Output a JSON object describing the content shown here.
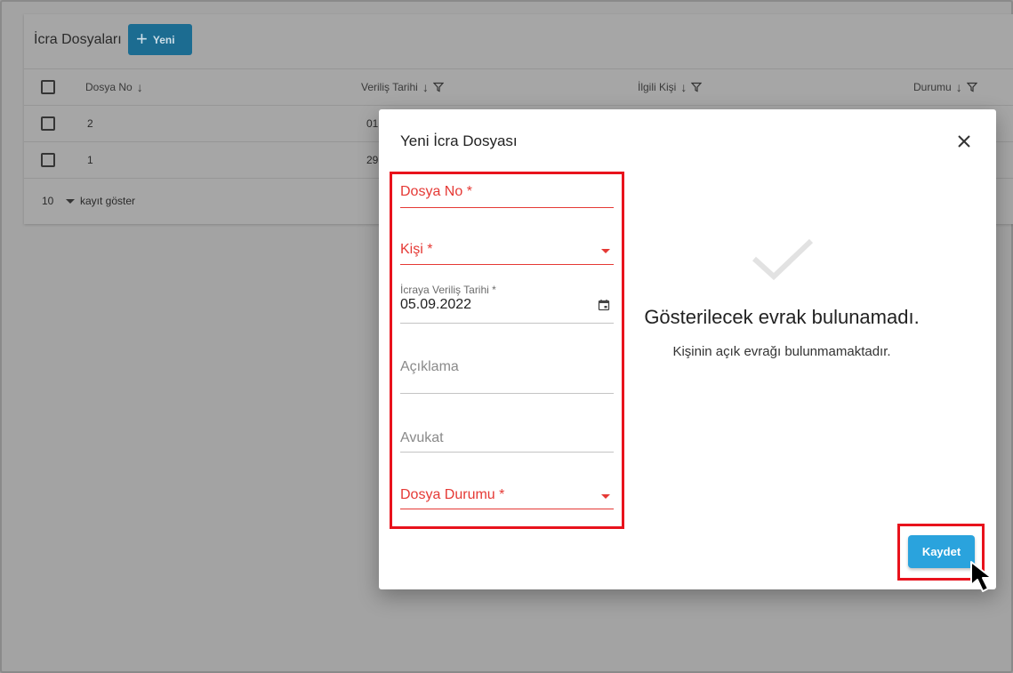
{
  "background": {
    "title": "İcra Dosyaları",
    "new_button_label": "Yeni",
    "new_button_icon": "plus-icon",
    "columns": [
      "Dosya No",
      "Veriliş Tarihi",
      "İlgili Kişi",
      "Durumu"
    ],
    "rows": [
      {
        "dosya_no": "2",
        "verilis_tarihi": "01"
      },
      {
        "dosya_no": "1",
        "verilis_tarihi": "29"
      }
    ],
    "page_size": "10",
    "page_size_label": "kayıt göster"
  },
  "modal": {
    "title": "Yeni İcra Dosyası",
    "fields": {
      "dosya_no": "Dosya No *",
      "kisi": "Kişi *",
      "verilis_tarihi_label": "İcraya Veriliş Tarihi *",
      "verilis_tarihi_value": "05.09.2022",
      "aciklama": "Açıklama",
      "avukat": "Avukat",
      "dosya_durumu": "Dosya Durumu *"
    },
    "empty_state": {
      "title": "Gösterilecek evrak bulunamadı.",
      "subtitle": "Kişinin açık evrağı bulunmamaktadır."
    },
    "save_label": "Kaydet"
  },
  "colors": {
    "accent": "#2aa3dd",
    "error": "#e53935",
    "highlight": "#e8121c"
  }
}
